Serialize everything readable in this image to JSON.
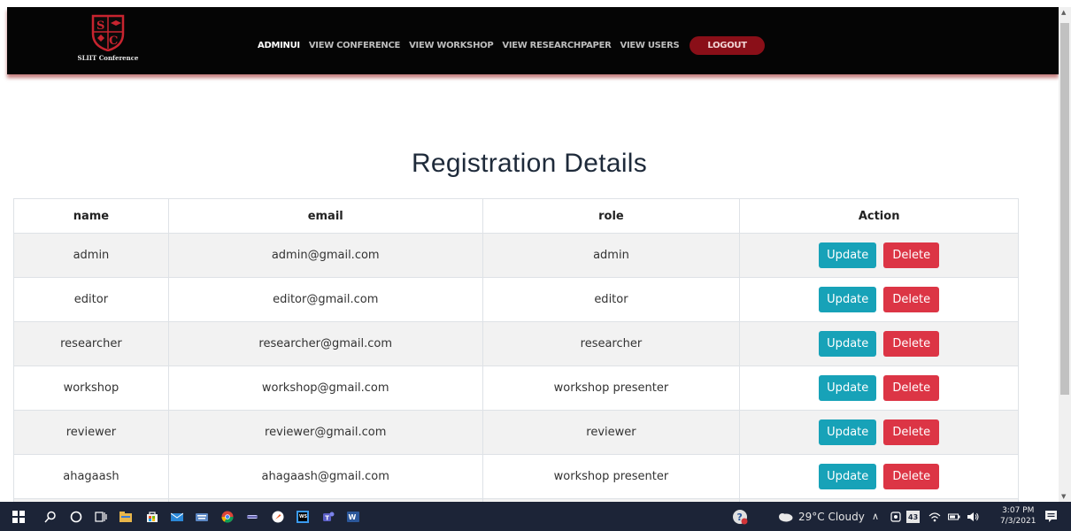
{
  "brand": {
    "logo_text": "SLIIT Conference",
    "logo_letters": "SC"
  },
  "nav": {
    "items": [
      "ADMINUI",
      "VIEW CONFERENCE",
      "VIEW WORKSHOP",
      "VIEW RESEARCHPAPER",
      "VIEW USERS"
    ],
    "logout_label": "LOGOUT"
  },
  "page": {
    "title": "Registration Details"
  },
  "table": {
    "headers": [
      "name",
      "email",
      "role",
      "Action"
    ],
    "rows": [
      {
        "name": "admin",
        "email": "admin@gmail.com",
        "role": "admin"
      },
      {
        "name": "editor",
        "email": "editor@gmail.com",
        "role": "editor"
      },
      {
        "name": "researcher",
        "email": "researcher@gmail.com",
        "role": "researcher"
      },
      {
        "name": "workshop",
        "email": "workshop@gmail.com",
        "role": "workshop presenter"
      },
      {
        "name": "reviewer",
        "email": "reviewer@gmail.com",
        "role": "reviewer"
      },
      {
        "name": "ahagaash",
        "email": "ahagaash@gmail.com",
        "role": "workshop presenter"
      }
    ],
    "update_label": "Update",
    "delete_label": "Delete"
  },
  "taskbar": {
    "weather": "29°C  Cloudy",
    "time": "3:07 PM",
    "date": "7/3/2021",
    "badge": "43"
  },
  "colors": {
    "navbar": "#050505",
    "logout": "#8a0f18",
    "update": "#17a2b8",
    "delete": "#dc3545",
    "taskbar": "#1c2437"
  }
}
